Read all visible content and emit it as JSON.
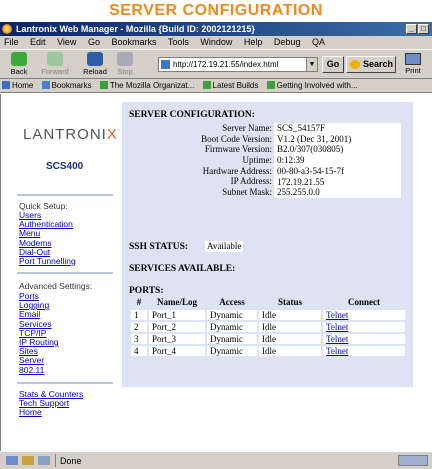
{
  "banner": "SERVER CONFIGURATION",
  "window": {
    "title": "Lantronix Web Manager - Mozilla {Build ID: 2002121215}"
  },
  "menu": [
    "File",
    "Edit",
    "View",
    "Go",
    "Bookmarks",
    "Tools",
    "Window",
    "Help",
    "Debug",
    "QA"
  ],
  "nav": {
    "back": "Back",
    "forward": "Forward",
    "reload": "Reload",
    "stop": "Stop",
    "url": "http://172.19.21.55/index.html",
    "go": "Go",
    "search": "Search",
    "print": "Print"
  },
  "bookmarks": [
    "Home",
    "Bookmarks",
    "The Mozilla Organizat...",
    "Latest Builds",
    "Getting Involved with..."
  ],
  "sidebar": {
    "logo": "LANTRONI",
    "logo_x": "X",
    "model": "SCS400",
    "quick_setup_label": "Quick Setup:",
    "quick_setup": [
      "Users",
      "Authentication",
      "Menu",
      "Modems",
      "Dial-Out",
      "Port Tunnelling"
    ],
    "advanced_label": "Advanced Settings:",
    "advanced": [
      "Ports",
      "Logging",
      "Email",
      "Services",
      "TCP/IP",
      "IP Routing",
      "Sites",
      "Server",
      "802.11"
    ],
    "misc": [
      "Stats & Counters",
      "Tech Support",
      "Home"
    ]
  },
  "server": {
    "title": "SERVER CONFIGURATION:",
    "fields": [
      {
        "label": "Server Name:",
        "value": "SCS_54157F"
      },
      {
        "label": "Boot Code Version:",
        "value": "V1.2 (Dec 31, 2001)"
      },
      {
        "label": "Firmware Version:",
        "value": "B2.0/307(030805)"
      },
      {
        "label": "Uptime:",
        "value": "0:12:39"
      },
      {
        "label": "Hardware Address:",
        "value": "00-80-a3-54-15-7f"
      },
      {
        "label": "IP Address:",
        "value": "172.19.21.55"
      },
      {
        "label": "Subnet Mask:",
        "value": "255.255.0.0"
      }
    ],
    "ssh_label": "SSH STATUS:",
    "ssh_value": "Available",
    "services_label": "SERVICES AVAILABLE:",
    "ports_label": "PORTS:"
  },
  "ports": {
    "headers": [
      "#",
      "Name/Log",
      "Access",
      "Status",
      "Connect"
    ],
    "rows": [
      {
        "num": "1",
        "name": "Port_1",
        "access": "Dynamic",
        "status": "Idle",
        "connect": "Telnet"
      },
      {
        "num": "2",
        "name": "Port_2",
        "access": "Dynamic",
        "status": "Idle",
        "connect": "Telnet"
      },
      {
        "num": "3",
        "name": "Port_3",
        "access": "Dynamic",
        "status": "Idle",
        "connect": "Telnet"
      },
      {
        "num": "4",
        "name": "Port_4",
        "access": "Dynamic",
        "status": "Idle",
        "connect": "Telnet"
      }
    ]
  },
  "status": {
    "text": "Done"
  },
  "colors": {
    "banner": "#f08a1e",
    "panel": "#dde3f3",
    "link": "#0000cc",
    "model": "#1a2c80"
  }
}
